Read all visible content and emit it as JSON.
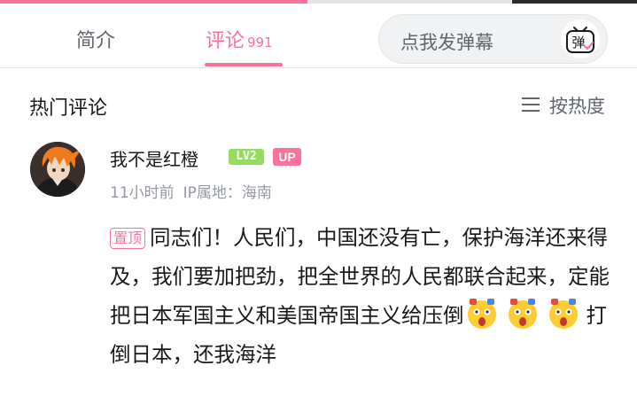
{
  "tabs": {
    "intro_label": "简介",
    "comments_label": "评论",
    "comments_count": "991"
  },
  "danmaku": {
    "placeholder": "点我发弹幕",
    "button_glyph": "弹"
  },
  "section": {
    "title": "热门评论",
    "sort_label": "按热度"
  },
  "comment": {
    "username": "我不是红橙",
    "level_badge": "LV2",
    "up_badge": "UP",
    "time": "11小时前",
    "ip_location": "IP属地：海南",
    "pinned_tag": "置顶",
    "text_main": "同志们！人民们，中国还没有亡，保护海洋还来得及，我们要加把劲，把全世界的人民都联合起来，定能把日本军国主义和美国帝国主义给压倒",
    "text_tail": "打倒日本，还我海洋",
    "emoji": "shocked-emoji"
  },
  "colors": {
    "accent": "#fb7299",
    "level_green": "#95dd5f",
    "muted_text": "#9499a0"
  }
}
